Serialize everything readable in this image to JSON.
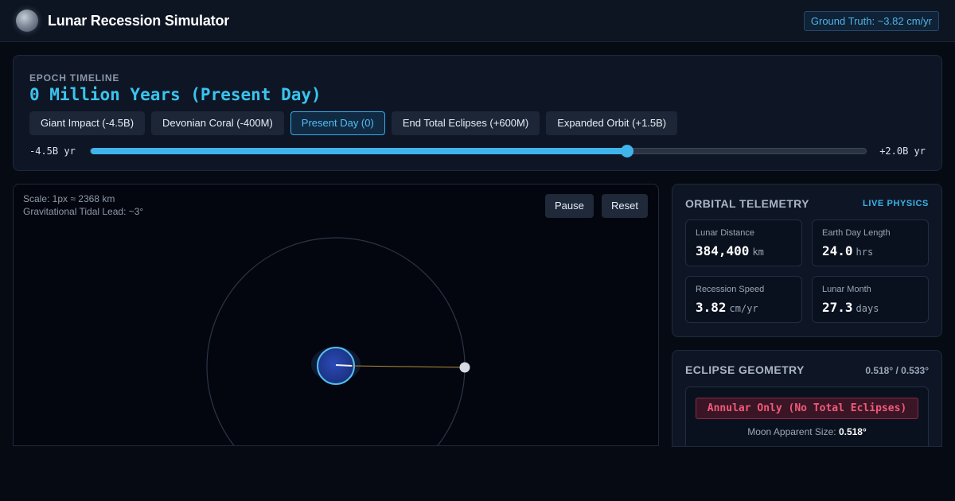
{
  "header": {
    "title": "Lunar Recession Simulator",
    "ground_truth": "Ground Truth: ~3.82 cm/yr"
  },
  "timeline": {
    "label": "EPOCH TIMELINE",
    "current_epoch": "0 Million Years (Present Day)",
    "buttons": [
      {
        "label": "Giant Impact (-4.5B)"
      },
      {
        "label": "Devonian Coral (-400M)"
      },
      {
        "label": "Present Day (0)"
      },
      {
        "label": "End Total Eclipses (+600M)"
      },
      {
        "label": "Expanded Orbit (+1.5B)"
      }
    ],
    "active_index": 2,
    "range_min": "-4.5B yr",
    "range_max": "+2.0B yr",
    "slider_fraction": 0.692
  },
  "simulation": {
    "scale_text": "Scale: 1px ≈ 2368 km",
    "tidal_lead_text": "Gravitational Tidal Lead: ~3°",
    "pause_label": "Pause",
    "reset_label": "Reset"
  },
  "telemetry": {
    "title": "ORBITAL TELEMETRY",
    "tag": "LIVE PHYSICS",
    "stats": [
      {
        "label": "Lunar Distance",
        "value": "384,400",
        "unit": "km"
      },
      {
        "label": "Earth Day Length",
        "value": "24.0",
        "unit": "hrs"
      },
      {
        "label": "Recession Speed",
        "value": "3.82",
        "unit": "cm/yr"
      },
      {
        "label": "Lunar Month",
        "value": "27.3",
        "unit": "days"
      }
    ]
  },
  "eclipse": {
    "title": "ECLIPSE GEOMETRY",
    "angles": "0.518° / 0.533°",
    "status": "Annular Only (No Total Eclipses)",
    "moon_size_label": "Moon Apparent Size:",
    "moon_size_value": "0.518°"
  },
  "colors": {
    "accent": "#3fb5ec",
    "warning": "#f25a78",
    "background": "#060a12"
  },
  "icons": {
    "logo": "moon-icon"
  }
}
